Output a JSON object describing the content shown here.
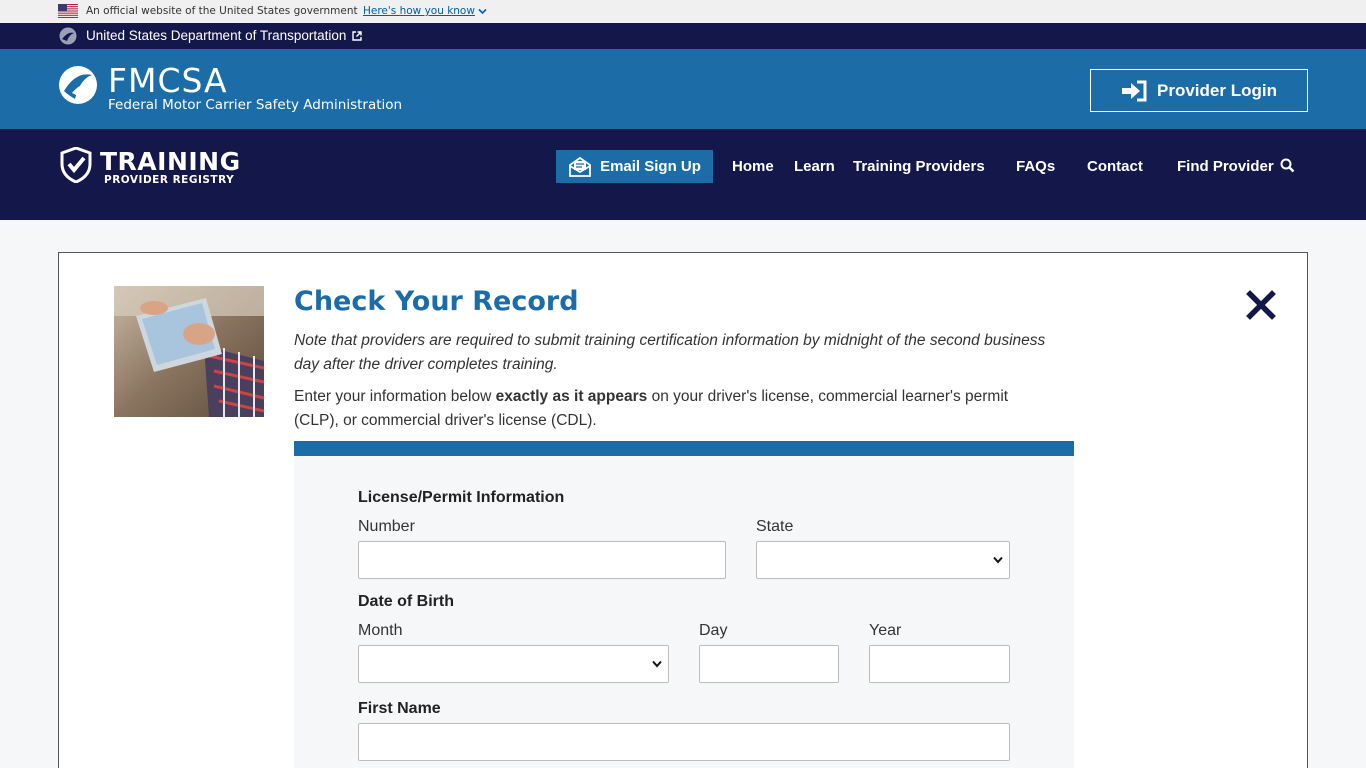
{
  "gov_banner": {
    "text": "An official website of the United States government",
    "link": "Here's how you know"
  },
  "dot_bar": {
    "link": "United States Department of Transportation"
  },
  "fmcsa": {
    "title": "FMCSA",
    "subtitle": "Federal Motor Carrier Safety Administration",
    "login_button": "Provider Login"
  },
  "nav": {
    "logo_training": "TRAINING",
    "logo_registry": "PROVIDER REGISTRY",
    "email_signup": "Email Sign Up",
    "items": [
      "Home",
      "Learn",
      "Training Providers",
      "FAQs",
      "Contact",
      "Find Provider"
    ]
  },
  "record": {
    "title": "Check Your Record",
    "note": "Note that providers are required to submit training certification information by midnight of the second business day after the driver completes training.",
    "instr_before": "Enter your information below ",
    "instr_bold": "exactly as it appears",
    "instr_after": " on your driver's license, commercial learner's permit (CLP), or commercial driver's license (CDL)."
  },
  "form": {
    "license_heading": "License/Permit Information",
    "number_label": "Number",
    "number_value": "",
    "state_label": "State",
    "state_value": "",
    "dob_heading": "Date of Birth",
    "month_label": "Month",
    "month_value": "",
    "day_label": "Day",
    "day_value": "",
    "year_label": "Year",
    "year_value": "",
    "first_name_label": "First Name",
    "first_name_value": ""
  },
  "colors": {
    "navy": "#14174a",
    "fmcsa_blue": "#1c6ca8",
    "link_blue": "#005ea2"
  }
}
